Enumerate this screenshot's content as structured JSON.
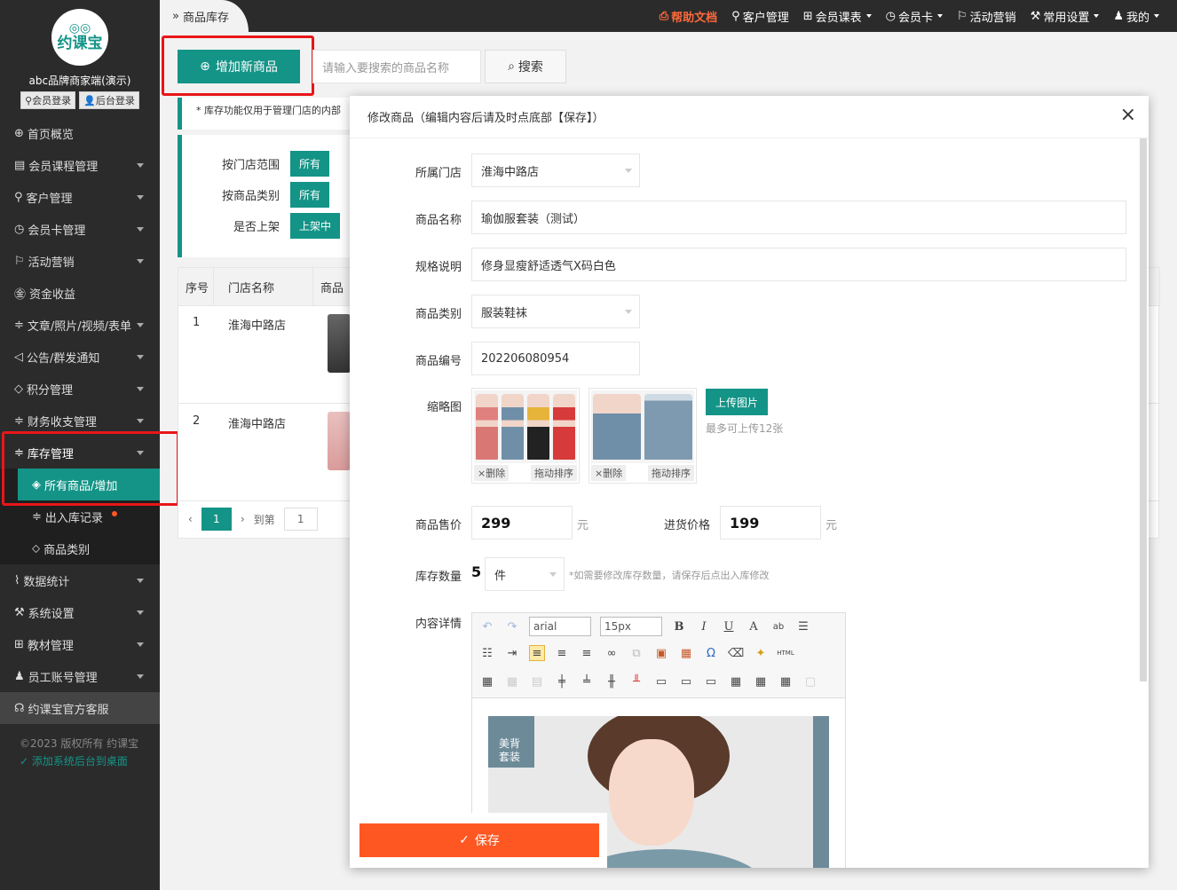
{
  "sidebar": {
    "logo_text": "约课宝",
    "logo_eyes": "◎◎",
    "brand": "abc品牌商家端(演示)",
    "member_login": "会员登录",
    "admin_login": "后台登录",
    "items": [
      {
        "label": "首页概览",
        "icon": "globe-icon"
      },
      {
        "label": "会员课程管理",
        "icon": "doc-icon"
      },
      {
        "label": "客户管理",
        "icon": "user-icon"
      },
      {
        "label": "会员卡管理",
        "icon": "clock-icon"
      },
      {
        "label": "活动营销",
        "icon": "flag-icon"
      },
      {
        "label": "资金收益",
        "icon": "yen-icon"
      },
      {
        "label": "文章/照片/视频/表单",
        "icon": "sliders-icon"
      },
      {
        "label": "公告/群发通知",
        "icon": "speaker-icon"
      },
      {
        "label": "积分管理",
        "icon": "diamond-icon"
      },
      {
        "label": "财务收支管理",
        "icon": "sliders-icon"
      },
      {
        "label": "库存管理",
        "icon": "sliders-icon"
      }
    ],
    "sub_items": [
      "所有商品/增加",
      "出入库记录",
      "商品类别"
    ],
    "items_after": [
      {
        "label": "数据统计",
        "icon": "chart-icon"
      },
      {
        "label": "系统设置",
        "icon": "tools-icon"
      },
      {
        "label": "教材管理",
        "icon": "book-icon"
      },
      {
        "label": "员工账号管理",
        "icon": "person-icon"
      }
    ],
    "service": "约课宝官方客服",
    "copyright": "©2023 版权所有 约课宝",
    "desktop_link": "添加系统后台到桌面"
  },
  "topbar": {
    "crumb": "商品库存",
    "help": "帮助文档",
    "customers": "客户管理",
    "schedule": "会员课表",
    "cards": "会员卡",
    "marketing": "活动营销",
    "settings": "常用设置",
    "mine": "我的"
  },
  "main": {
    "add_button": "增加新商品",
    "search_placeholder": "请输入要搜索的商品名称",
    "search_button": "搜索",
    "notice": "* 库存功能仅用于管理门店的内部",
    "filters": [
      {
        "label": "按门店范围",
        "chip": "所有"
      },
      {
        "label": "按商品类别",
        "chip": "所有"
      },
      {
        "label": "是否上架",
        "chip": "上架中"
      }
    ],
    "table_headers": [
      "序号",
      "门店名称",
      "商品"
    ],
    "rows": [
      {
        "no": "1",
        "store": "淮海中路店"
      },
      {
        "no": "2",
        "store": "淮海中路店"
      }
    ],
    "pager": {
      "current": "1",
      "goto": "到第",
      "page_input": "1"
    }
  },
  "modal": {
    "title": "修改商品（编辑内容后请及时点底部【保存】）",
    "close": "×",
    "store_label": "所属门店",
    "store_value": "淮海中路店",
    "name_label": "商品名称",
    "name_value": "瑜伽服套装（测试）",
    "spec_label": "规格说明",
    "spec_value": "修身显瘦舒适透气X码白色",
    "category_label": "商品类别",
    "category_value": "服装鞋袜",
    "code_label": "商品编号",
    "code_value": "202206080954",
    "thumb_label": "缩略图",
    "thumb_delete": "×删除",
    "thumb_sort": "拖动排序",
    "upload_button": "上传图片",
    "upload_hint": "最多可上传12张",
    "price_label": "商品售价",
    "price_value": "299",
    "currency": "元",
    "cost_label": "进货价格",
    "cost_value": "199",
    "stock_label": "库存数量",
    "stock_value": "5",
    "stock_unit": "件",
    "stock_hint": "*如需要修改库存数量，请保存后点出入库修改",
    "content_label": "内容详情",
    "editor": {
      "font": "arial",
      "size": "15px",
      "image_ribbon_1": "美背",
      "image_ribbon_2": "套装"
    },
    "save_button": "保存"
  },
  "colors": {
    "accent": "#149487",
    "save": "#ff5722",
    "highlight": "#e8161a"
  }
}
